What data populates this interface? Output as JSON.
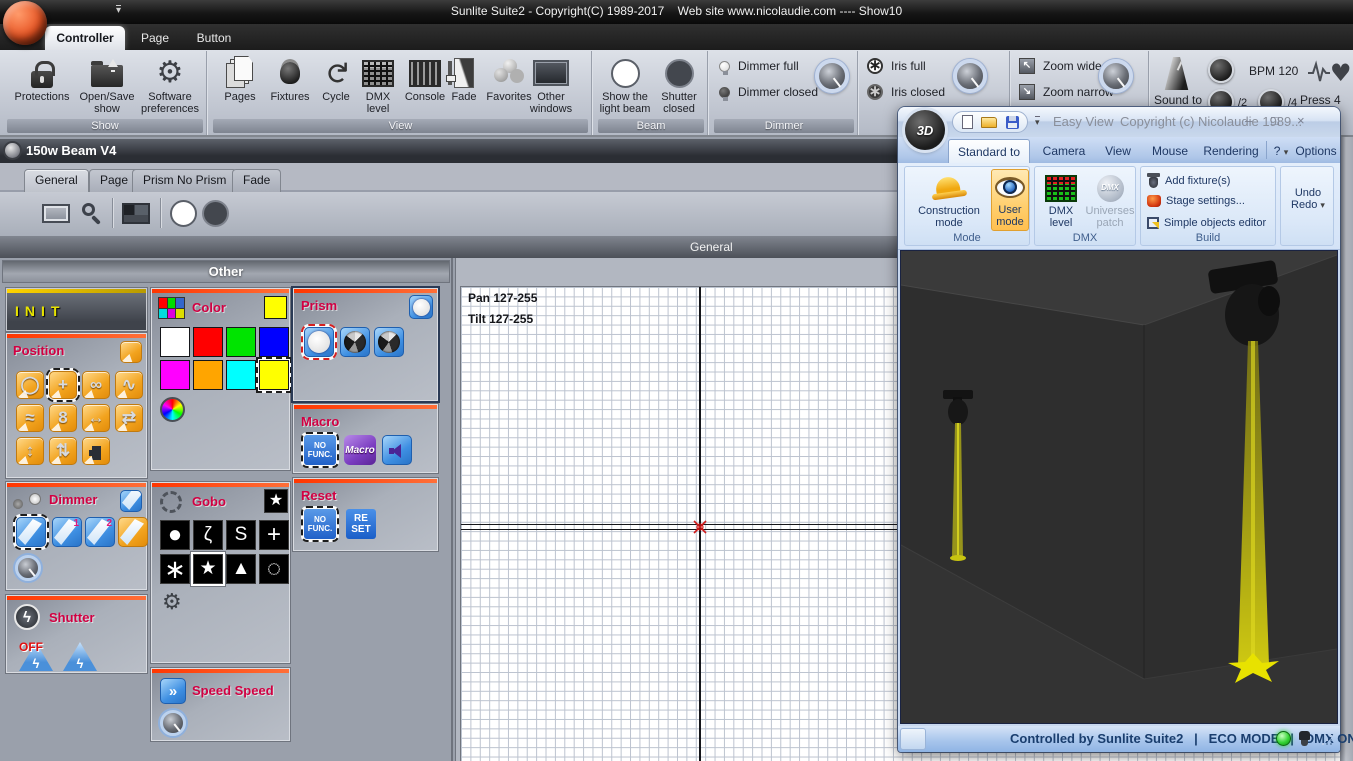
{
  "app": {
    "title": "Sunlite Suite2 - Copyright(C) 1989-2017    Web site www.nicolaudie.com ---- Show10",
    "tabs": [
      {
        "label": "Controller"
      },
      {
        "label": "Page"
      },
      {
        "label": "Button"
      }
    ]
  },
  "ribbon": {
    "show": {
      "label": "Show",
      "protections": "Protections",
      "open_save": "Open/Save show",
      "preferences": "Software preferences"
    },
    "view": {
      "label": "View",
      "items": [
        {
          "label": "Pages"
        },
        {
          "label": "Fixtures"
        },
        {
          "label": "Cycle"
        },
        {
          "label": "DMX level"
        },
        {
          "label": "Console"
        },
        {
          "label": "Fade"
        },
        {
          "label": "Favorites"
        },
        {
          "label": "Other windows"
        }
      ]
    },
    "beam": {
      "label": "Beam",
      "show_beam": "Show the light beam",
      "shutter_closed": "Shutter closed"
    },
    "dimmer": {
      "label": "Dimmer",
      "full": "Dimmer full",
      "closed": "Dimmer closed"
    },
    "iris": {
      "full": "Iris full",
      "closed": "Iris closed"
    },
    "zoom": {
      "wide": "Zoom wide",
      "narrow": "Zoom narrow"
    },
    "sound": {
      "sound_to": "Sound to",
      "bpm": "BPM 120",
      "div2": "/2",
      "div4": "/4",
      "press": "Press 4"
    }
  },
  "beam_window": {
    "title": "150w Beam V4",
    "tabs": [
      {
        "label": "General"
      },
      {
        "label": "Page"
      },
      {
        "label": "Prism No Prism"
      },
      {
        "label": "Fade"
      }
    ],
    "section_band": "General",
    "panel_group_title": "Other",
    "init_label": "INIT",
    "position_title": "Position",
    "dimmer_title": "Dimmer",
    "dimmer_n1": "1",
    "dimmer_n2": "2",
    "shutter_title": "Shutter",
    "shutter_off": "OFF",
    "color_title": "Color",
    "gobo_title": "Gobo",
    "speed_title": "Speed Speed",
    "prism_title": "Prism",
    "macro_title": "Macro",
    "reset_title": "Reset",
    "no_func_1": "NO",
    "no_func_2": "FUNC.",
    "macro_btn": "Macro",
    "reset_1": "RE",
    "reset_2": "SET",
    "grid_pan": "Pan 127-255",
    "grid_tilt": "Tilt 127-255"
  },
  "easy_view": {
    "logo": "3D",
    "title": "Easy View",
    "subtitle": "Copyright (c) Nicolaudie 1989...",
    "tabs": [
      {
        "label": "Standard to"
      },
      {
        "label": "Camera"
      },
      {
        "label": "View"
      },
      {
        "label": "Mouse"
      },
      {
        "label": "Rendering"
      }
    ],
    "help": "?",
    "options": "Options",
    "mode_label": "Mode",
    "construction": "Construction mode",
    "user": "User mode",
    "dmx_label": "DMX",
    "dmx_level": "DMX level",
    "universes_patch": "Universes patch",
    "dmx_globe": "DMX",
    "build_label": "Build",
    "add_fixture": "Add fixture(s)",
    "stage_settings": "Stage settings...",
    "objects_editor": "Simple objects editor",
    "undo": "Undo",
    "redo": "Redo",
    "status": "Controlled by Sunlite Suite2   |   ECO MODE   |   DMX ON"
  },
  "glyphs": {
    "dropdown": "▾",
    "gear": "⚙",
    "cycle": "↻",
    "heart": "♥",
    "asterisk": "∗",
    "lightning": "ϟ",
    "star": "★",
    "speed": "»",
    "zoom_out": "↖",
    "zoom_in": "↘",
    "minimize": "–",
    "maximize": "□",
    "close": "×",
    "position": [
      "◯",
      "+",
      "∞",
      "∿",
      "≈",
      "8",
      "↔",
      "⇄",
      "↕",
      "⇅"
    ],
    "gobo": [
      "●",
      "ζ",
      "S",
      "+",
      "∗",
      "★",
      "▲",
      "◌"
    ]
  },
  "colors": {
    "panel_title_red": "#d10042",
    "panel_bar_red": "#ff3600",
    "init_yellow": "#e8e400",
    "led_green": "#35d435",
    "beam_yellow": "#d6d010",
    "swatches": [
      "#ffffff",
      "#ff0000",
      "#00e400",
      "#0000ff",
      "#ff00ff",
      "#ffa500",
      "#00ffff",
      "#ffff00"
    ]
  }
}
